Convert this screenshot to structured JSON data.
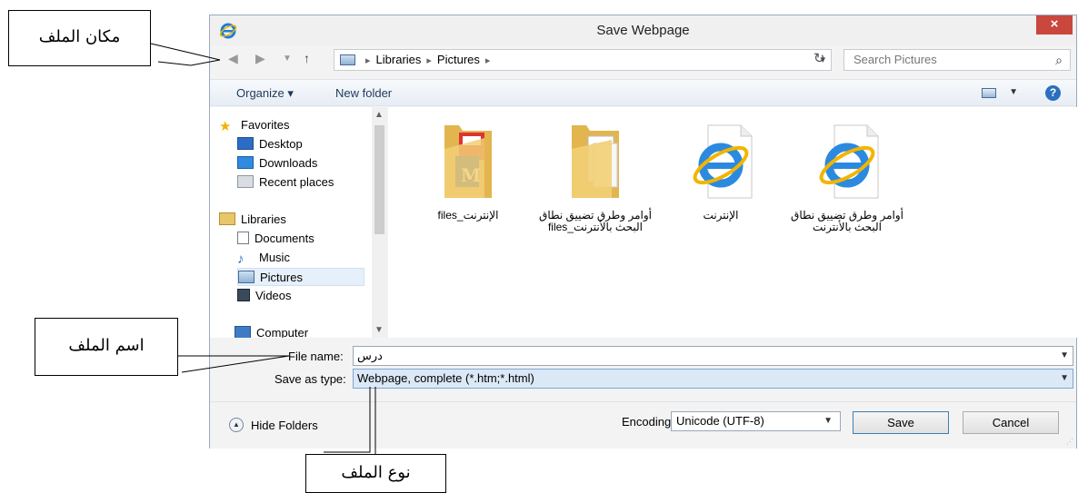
{
  "dialog": {
    "title": "Save Webpage",
    "close_label": "×",
    "address": {
      "crumbs": [
        "Libraries",
        "Pictures"
      ],
      "search_placeholder": "Search Pictures"
    },
    "toolbar": {
      "organize_label": "Organize ▾",
      "new_folder_label": "New folder",
      "help_label": "?"
    },
    "nav": {
      "favorites": "Favorites",
      "desktop": "Desktop",
      "downloads": "Downloads",
      "recent_places": "Recent places",
      "libraries": "Libraries",
      "documents": "Documents",
      "music": "Music",
      "pictures": "Pictures",
      "videos": "Videos",
      "computer": "Computer"
    },
    "files": [
      {
        "name": "الإنترنت_files",
        "type": "folder"
      },
      {
        "name": "أوامر وطرق تضييق نطاق البحث بالأنترنت_files",
        "type": "folder"
      },
      {
        "name": "الإنترنت",
        "type": "ie-document"
      },
      {
        "name": "أوامر وطرق تضييق نطاق البحث بالأنترنت",
        "type": "ie-document"
      }
    ],
    "file_name_label": "File name:",
    "file_name_value": "درس",
    "save_as_type_label": "Save as type:",
    "save_as_type_value": "Webpage, complete (*.htm;*.html)",
    "hide_folders_label": "Hide Folders",
    "encoding_label": "Encoding:",
    "encoding_value": "Unicode (UTF-8)",
    "save_label": "Save",
    "cancel_label": "Cancel"
  },
  "annotations": {
    "file_location": "مكان الملف",
    "file_name": "اسم الملف",
    "file_type": "نوع الملف"
  },
  "colors": {
    "close_button": "#c9473d",
    "selection": "#e5f0fb",
    "toolbar_text": "#1e395b"
  }
}
